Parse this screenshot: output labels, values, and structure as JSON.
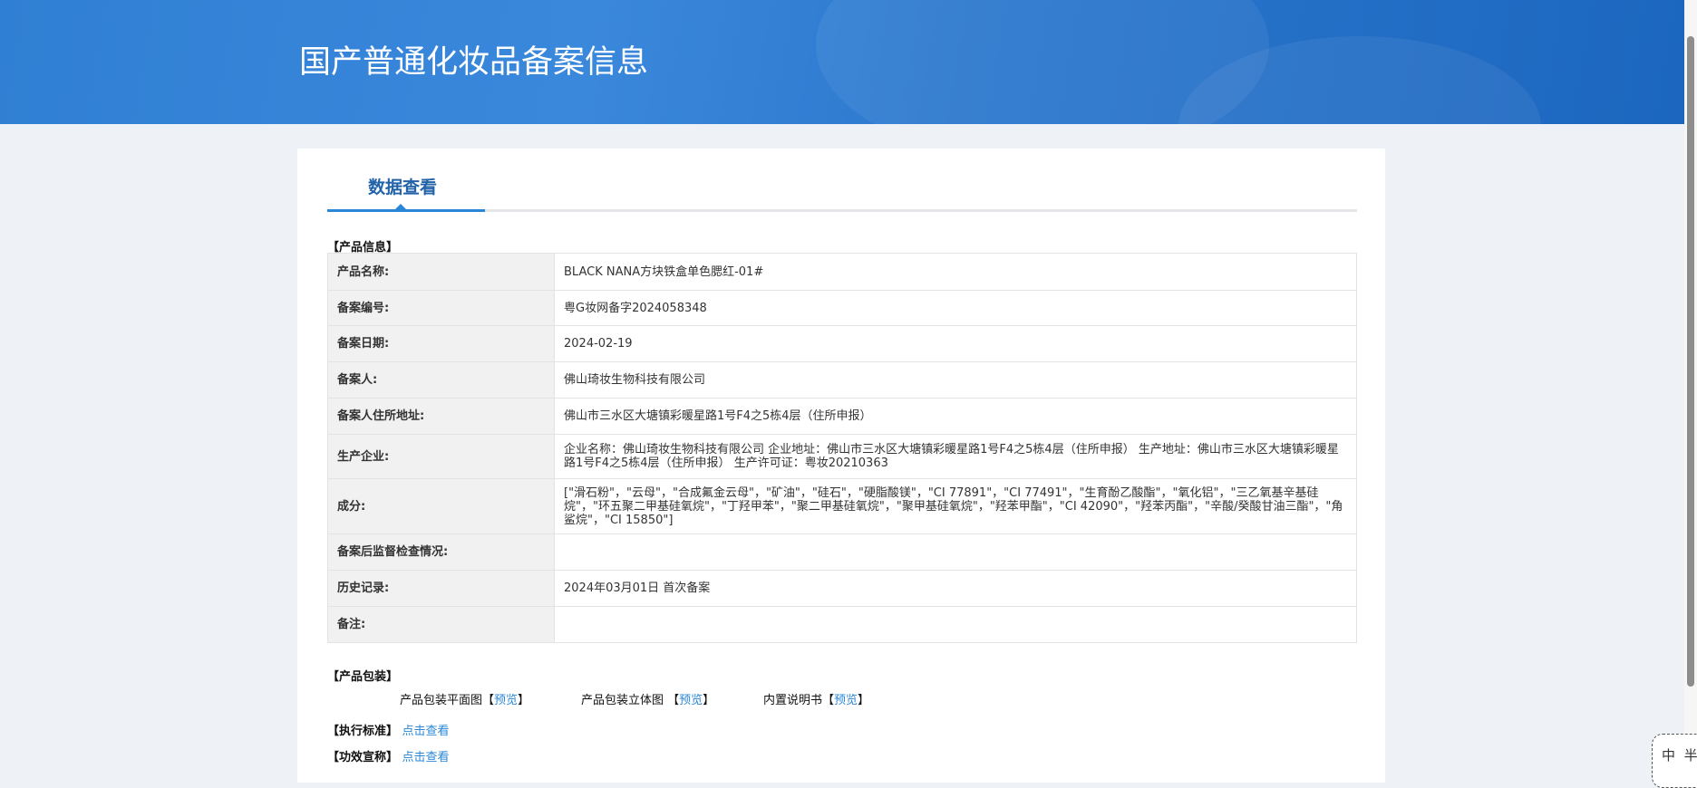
{
  "header": {
    "title": "国产普通化妆品备案信息"
  },
  "tabs": [
    {
      "label": "数据查看",
      "active": true
    }
  ],
  "product_info": {
    "section_title": "【产品信息】",
    "rows": [
      {
        "label": "产品名称:",
        "value": "BLACK NANA方块铁盒单色腮红-01#"
      },
      {
        "label": "备案编号:",
        "value": "粤G妆网备字2024058348"
      },
      {
        "label": "备案日期:",
        "value": "2024-02-19"
      },
      {
        "label": "备案人:",
        "value": "佛山琦妆生物科技有限公司"
      },
      {
        "label": "备案人住所地址:",
        "value": "佛山市三水区大塘镇彩暖星路1号F4之5栋4层（住所申报）"
      },
      {
        "label": "生产企业:",
        "value": "企业名称：佛山琦妆生物科技有限公司 企业地址：佛山市三水区大塘镇彩暖星路1号F4之5栋4层（住所申报） 生产地址：佛山市三水区大塘镇彩暖星路1号F4之5栋4层（住所申报） 生产许可证：粤妆20210363"
      },
      {
        "label": "成分:",
        "value": "[\"滑石粉\"，\"云母\"，\"合成氟金云母\"，\"矿油\"，\"硅石\"，\"硬脂酸镁\"，\"CI 77891\"，\"CI 77491\"，\"生育酚乙酸酯\"，\"氧化铝\"，\"三乙氧基辛基硅烷\"，\"环五聚二甲基硅氧烷\"，\"丁羟甲苯\"，\"聚二甲基硅氧烷\"，\"聚甲基硅氧烷\"，\"羟苯甲酯\"，\"CI 42090\"，\"羟苯丙酯\"，\"辛酸/癸酸甘油三酯\"，\"角鲨烷\"，\"CI 15850\"]"
      },
      {
        "label": "备案后监督检查情况:",
        "value": ""
      },
      {
        "label": "历史记录:",
        "value": "2024年03月01日 首次备案"
      },
      {
        "label": "备注:",
        "value": ""
      }
    ]
  },
  "packaging": {
    "section_title": "【产品包装】",
    "items": [
      {
        "label": "产品包装平面图【",
        "link": "预览",
        "end": "】"
      },
      {
        "label": "产品包装立体图 【",
        "link": "预览",
        "end": "】"
      },
      {
        "label": "内置说明书【",
        "link": "预览",
        "end": "】"
      }
    ]
  },
  "standard": {
    "label": "【执行标准】",
    "link": "点击查看"
  },
  "efficacy": {
    "label": "【功效宣称】",
    "link": "点击查看"
  },
  "ime": {
    "mode": "中",
    "width": "半"
  },
  "colors": {
    "header": "#2f7fd4",
    "accent": "#2a87d8",
    "tab_text": "#2262a8",
    "background": "#eef2f6"
  }
}
